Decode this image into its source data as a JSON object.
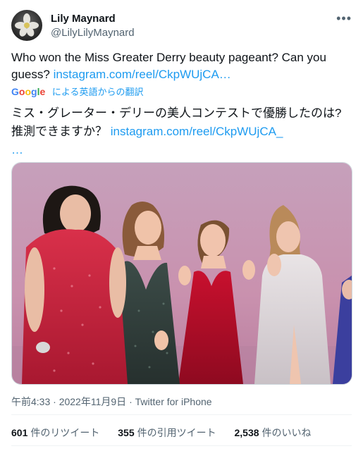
{
  "user": {
    "name": "Lily Maynard",
    "handle": "@LilyLilyMaynard"
  },
  "tweet": {
    "text_en": "Who won the Miss Greater Derry beauty pageant? Can you guess?",
    "link_en": "instagram.com/reel/CkpWUjCA…",
    "translation_label": "による英語からの翻訳",
    "google_label": "Google",
    "text_jp": "ミス・グレーター・デリーの美人コンテストで優勝したのは?推測できますか？",
    "link_jp": "instagram.com/reel/CkpWUjCA_",
    "link_jp_ellipsis": "…"
  },
  "meta": {
    "time": "午前4:33",
    "date": "2022年11月9日",
    "source": "Twitter for iPhone"
  },
  "stats": {
    "retweets": "601",
    "retweets_label": "件のリツイート",
    "quotes": "355",
    "quotes_label": "件の引用ツイート",
    "likes": "2,538",
    "likes_label": "件のいいね"
  },
  "icons": {
    "more": "more-icon",
    "avatar": "avatar-image"
  },
  "colors": {
    "link": "#1d9bf0",
    "secondary_text": "#536471",
    "stage_background": "#c99ab3"
  }
}
